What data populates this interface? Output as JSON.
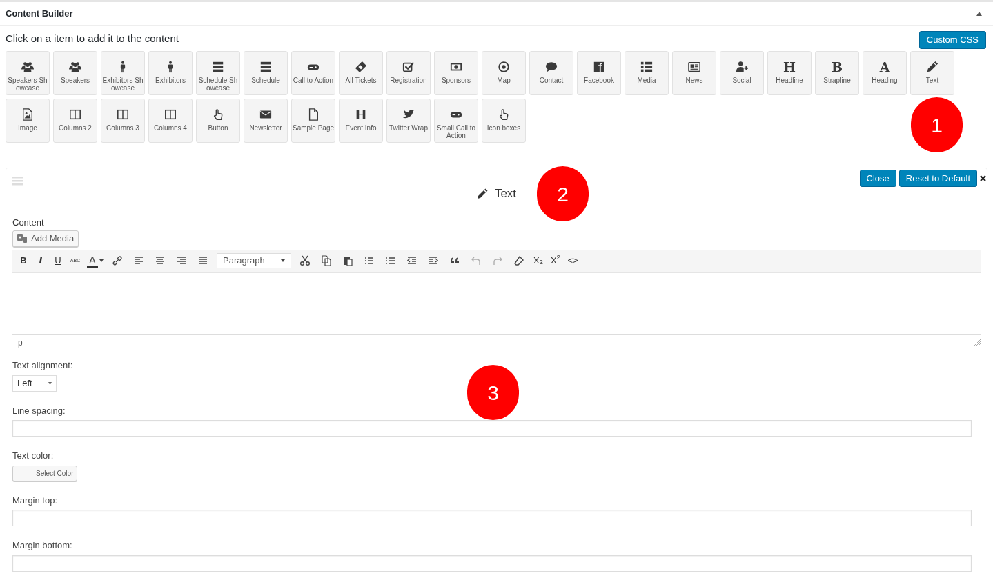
{
  "header": {
    "title": "Content Builder"
  },
  "instruction": "Click on a item to add it to the content",
  "custom_css_button": "Custom CSS",
  "elements": [
    {
      "label": "Speakers Showcase"
    },
    {
      "label": "Speakers"
    },
    {
      "label": "Exhibitors Showcase"
    },
    {
      "label": "Exhibitors"
    },
    {
      "label": "Schedule Showcase"
    },
    {
      "label": "Schedule"
    },
    {
      "label": "Call to Action"
    },
    {
      "label": "All Tickets"
    },
    {
      "label": "Registration"
    },
    {
      "label": "Sponsors"
    },
    {
      "label": "Map"
    },
    {
      "label": "Contact"
    },
    {
      "label": "Facebook"
    },
    {
      "label": "Media"
    },
    {
      "label": "News"
    },
    {
      "label": "Social"
    },
    {
      "label": "Headline",
      "glyph": "H"
    },
    {
      "label": "Strapline",
      "glyph": "B"
    },
    {
      "label": "Heading",
      "glyph": "A"
    },
    {
      "label": "Text"
    },
    {
      "label": "Image"
    },
    {
      "label": "Columns 2"
    },
    {
      "label": "Columns 3"
    },
    {
      "label": "Columns 4"
    },
    {
      "label": "Button"
    },
    {
      "label": "Newsletter"
    },
    {
      "label": "Sample Page"
    },
    {
      "label": "Event Info",
      "glyph": "H"
    },
    {
      "label": "Twitter Wrap"
    },
    {
      "label": "Small Call to Action"
    },
    {
      "label": "Icon boxes"
    }
  ],
  "annotations": [
    {
      "number": "1"
    },
    {
      "number": "2"
    },
    {
      "number": "3"
    }
  ],
  "panel": {
    "title": "Text",
    "buttons": [
      "Close",
      "Reset to Default"
    ],
    "content_label": "Content",
    "add_media": "Add Media",
    "toolbar": [
      {
        "kind": "glyph",
        "text": "B",
        "disabled": false
      },
      {
        "kind": "glyph",
        "text": "I",
        "disabled": false
      },
      {
        "kind": "glyph",
        "text": "U",
        "disabled": false
      },
      {
        "kind": "glyph",
        "text": "ABC",
        "disabled": false
      },
      {
        "kind": "glyph",
        "text": "A",
        "disabled": false
      },
      {
        "kind": "icon",
        "disabled": false
      },
      {
        "kind": "icon",
        "disabled": false
      },
      {
        "kind": "icon",
        "disabled": false
      },
      {
        "kind": "icon",
        "disabled": false
      },
      {
        "kind": "icon",
        "disabled": false
      },
      {
        "kind": "select",
        "text": "Paragraph"
      },
      {
        "kind": "icon",
        "disabled": false
      },
      {
        "kind": "icon",
        "disabled": false
      },
      {
        "kind": "icon",
        "disabled": false
      },
      {
        "kind": "icon",
        "disabled": false
      },
      {
        "kind": "icon",
        "disabled": false
      },
      {
        "kind": "icon",
        "disabled": false
      },
      {
        "kind": "icon",
        "disabled": false
      },
      {
        "kind": "icon",
        "disabled": false
      },
      {
        "kind": "icon",
        "disabled": true
      },
      {
        "kind": "icon",
        "disabled": true
      },
      {
        "kind": "icon",
        "disabled": false
      },
      {
        "kind": "glyph",
        "text": "X$_{2}$",
        "disabled": false
      },
      {
        "kind": "glyph",
        "text": "X$^{2}$",
        "disabled": false
      },
      {
        "kind": "glyph",
        "text": "<>",
        "disabled": false
      }
    ],
    "path": "p",
    "fields": [
      {
        "kind": "select",
        "label": "Text alignment:",
        "value": "Left"
      },
      {
        "kind": "text",
        "label": "Line spacing:"
      },
      {
        "kind": "color",
        "label": "Text color:",
        "button": "Select Color"
      },
      {
        "kind": "text",
        "label": "Margin top:"
      },
      {
        "kind": "text",
        "label": "Margin bottom:"
      }
    ]
  }
}
